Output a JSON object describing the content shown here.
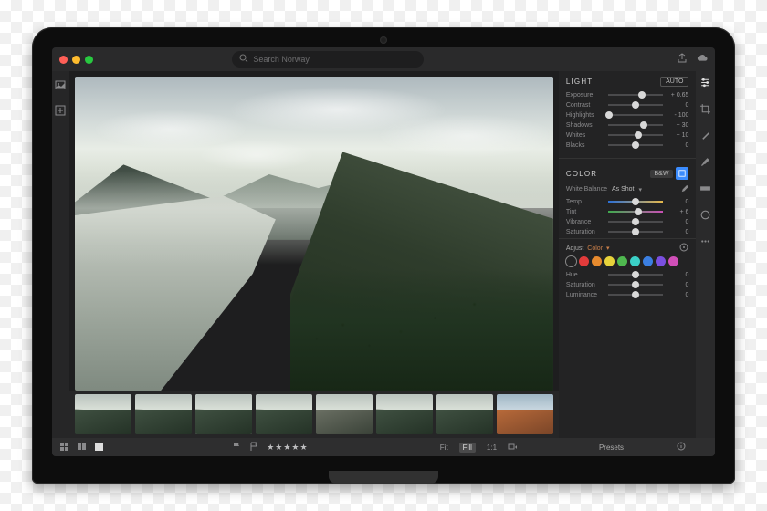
{
  "search": {
    "placeholder": "Search Norway"
  },
  "light": {
    "title": "LIGHT",
    "auto": "AUTO",
    "sliders": [
      {
        "label": "Exposure",
        "value": "+ 0.65",
        "pos": 62
      },
      {
        "label": "Contrast",
        "value": "0",
        "pos": 50
      },
      {
        "label": "Highlights",
        "value": "- 100",
        "pos": 2
      },
      {
        "label": "Shadows",
        "value": "+ 30",
        "pos": 65
      },
      {
        "label": "Whites",
        "value": "+ 10",
        "pos": 55
      },
      {
        "label": "Blacks",
        "value": "0",
        "pos": 50
      }
    ]
  },
  "color": {
    "title": "COLOR",
    "bw": "B&W",
    "wb_label": "White Balance",
    "wb_value": "As Shot",
    "sliders": [
      {
        "label": "Temp",
        "value": "0",
        "pos": 50,
        "g1": "#2b6fd6",
        "g2": "#e6b84a"
      },
      {
        "label": "Tint",
        "value": "+ 6",
        "pos": 54,
        "g1": "#3faa4d",
        "g2": "#c94fb5"
      },
      {
        "label": "Vibrance",
        "value": "0",
        "pos": 50
      },
      {
        "label": "Saturation",
        "value": "0",
        "pos": 50
      }
    ],
    "adjust_label": "Adjust",
    "adjust_mode": "Color",
    "swatches": [
      "#e23b3b",
      "#e68a2e",
      "#e6d23b",
      "#4fb84f",
      "#3bd0c7",
      "#3b7fe2",
      "#7a4fe0",
      "#d04fb8"
    ],
    "hsl": [
      {
        "label": "Hue",
        "value": "0",
        "pos": 50
      },
      {
        "label": "Saturation",
        "value": "0",
        "pos": 50
      },
      {
        "label": "Luminance",
        "value": "0",
        "pos": 50
      }
    ]
  },
  "status": {
    "stars": "★★★★★",
    "fit": "Fit",
    "fill": "Fill",
    "one_to_one": "1:1",
    "presets": "Presets"
  }
}
